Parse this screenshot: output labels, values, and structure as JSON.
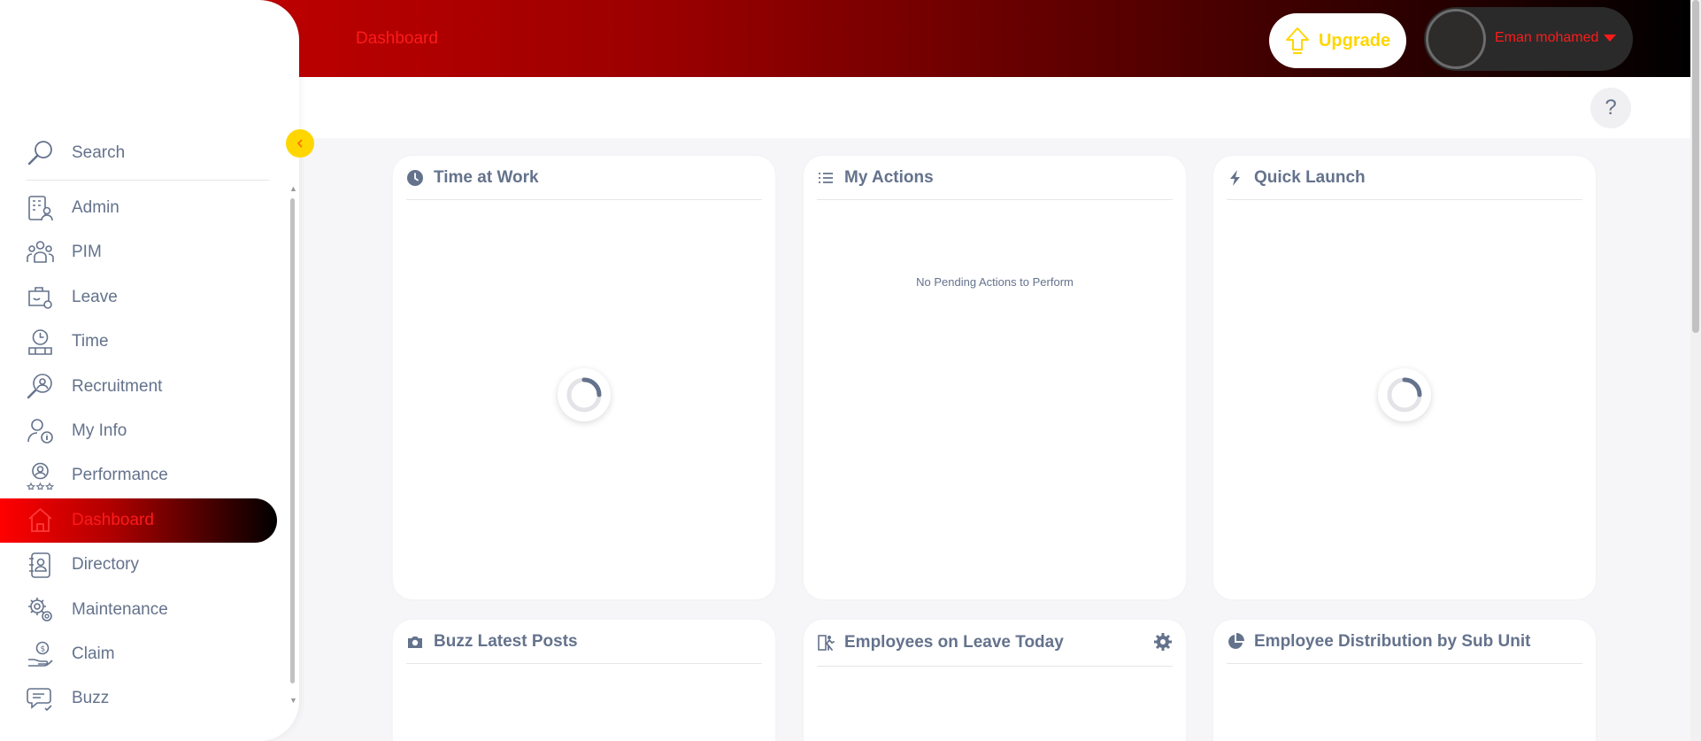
{
  "header": {
    "page_title": "Dashboard",
    "upgrade_label": "Upgrade",
    "user_name": "Eman mohamed",
    "help_label": "?"
  },
  "sidebar": {
    "search_label": "Search",
    "items": [
      {
        "label": "Admin",
        "icon": "admin-icon"
      },
      {
        "label": "PIM",
        "icon": "pim-icon"
      },
      {
        "label": "Leave",
        "icon": "leave-icon"
      },
      {
        "label": "Time",
        "icon": "time-icon"
      },
      {
        "label": "Recruitment",
        "icon": "recruitment-icon"
      },
      {
        "label": "My Info",
        "icon": "my-info-icon"
      },
      {
        "label": "Performance",
        "icon": "performance-icon"
      },
      {
        "label": "Dashboard",
        "icon": "home-icon",
        "active": true
      },
      {
        "label": "Directory",
        "icon": "directory-icon"
      },
      {
        "label": "Maintenance",
        "icon": "maintenance-icon"
      },
      {
        "label": "Claim",
        "icon": "claim-icon"
      },
      {
        "label": "Buzz",
        "icon": "buzz-icon"
      }
    ]
  },
  "widgets": [
    {
      "title": "Time at Work",
      "icon": "clock-icon",
      "state": "loading"
    },
    {
      "title": "My Actions",
      "icon": "list-icon",
      "empty_text": "No Pending Actions to Perform"
    },
    {
      "title": "Quick Launch",
      "icon": "lightning-icon",
      "state": "loading"
    },
    {
      "title": "Buzz Latest Posts",
      "icon": "camera-icon"
    },
    {
      "title": "Employees on Leave Today",
      "icon": "leave-person-icon"
    },
    {
      "title": "Employee Distribution by Sub Unit",
      "icon": "pie-chart-icon"
    }
  ],
  "colors": {
    "accent_red": "#ff1a1a",
    "upgrade_yellow": "#ffd600",
    "text_gray": "#64728c"
  }
}
